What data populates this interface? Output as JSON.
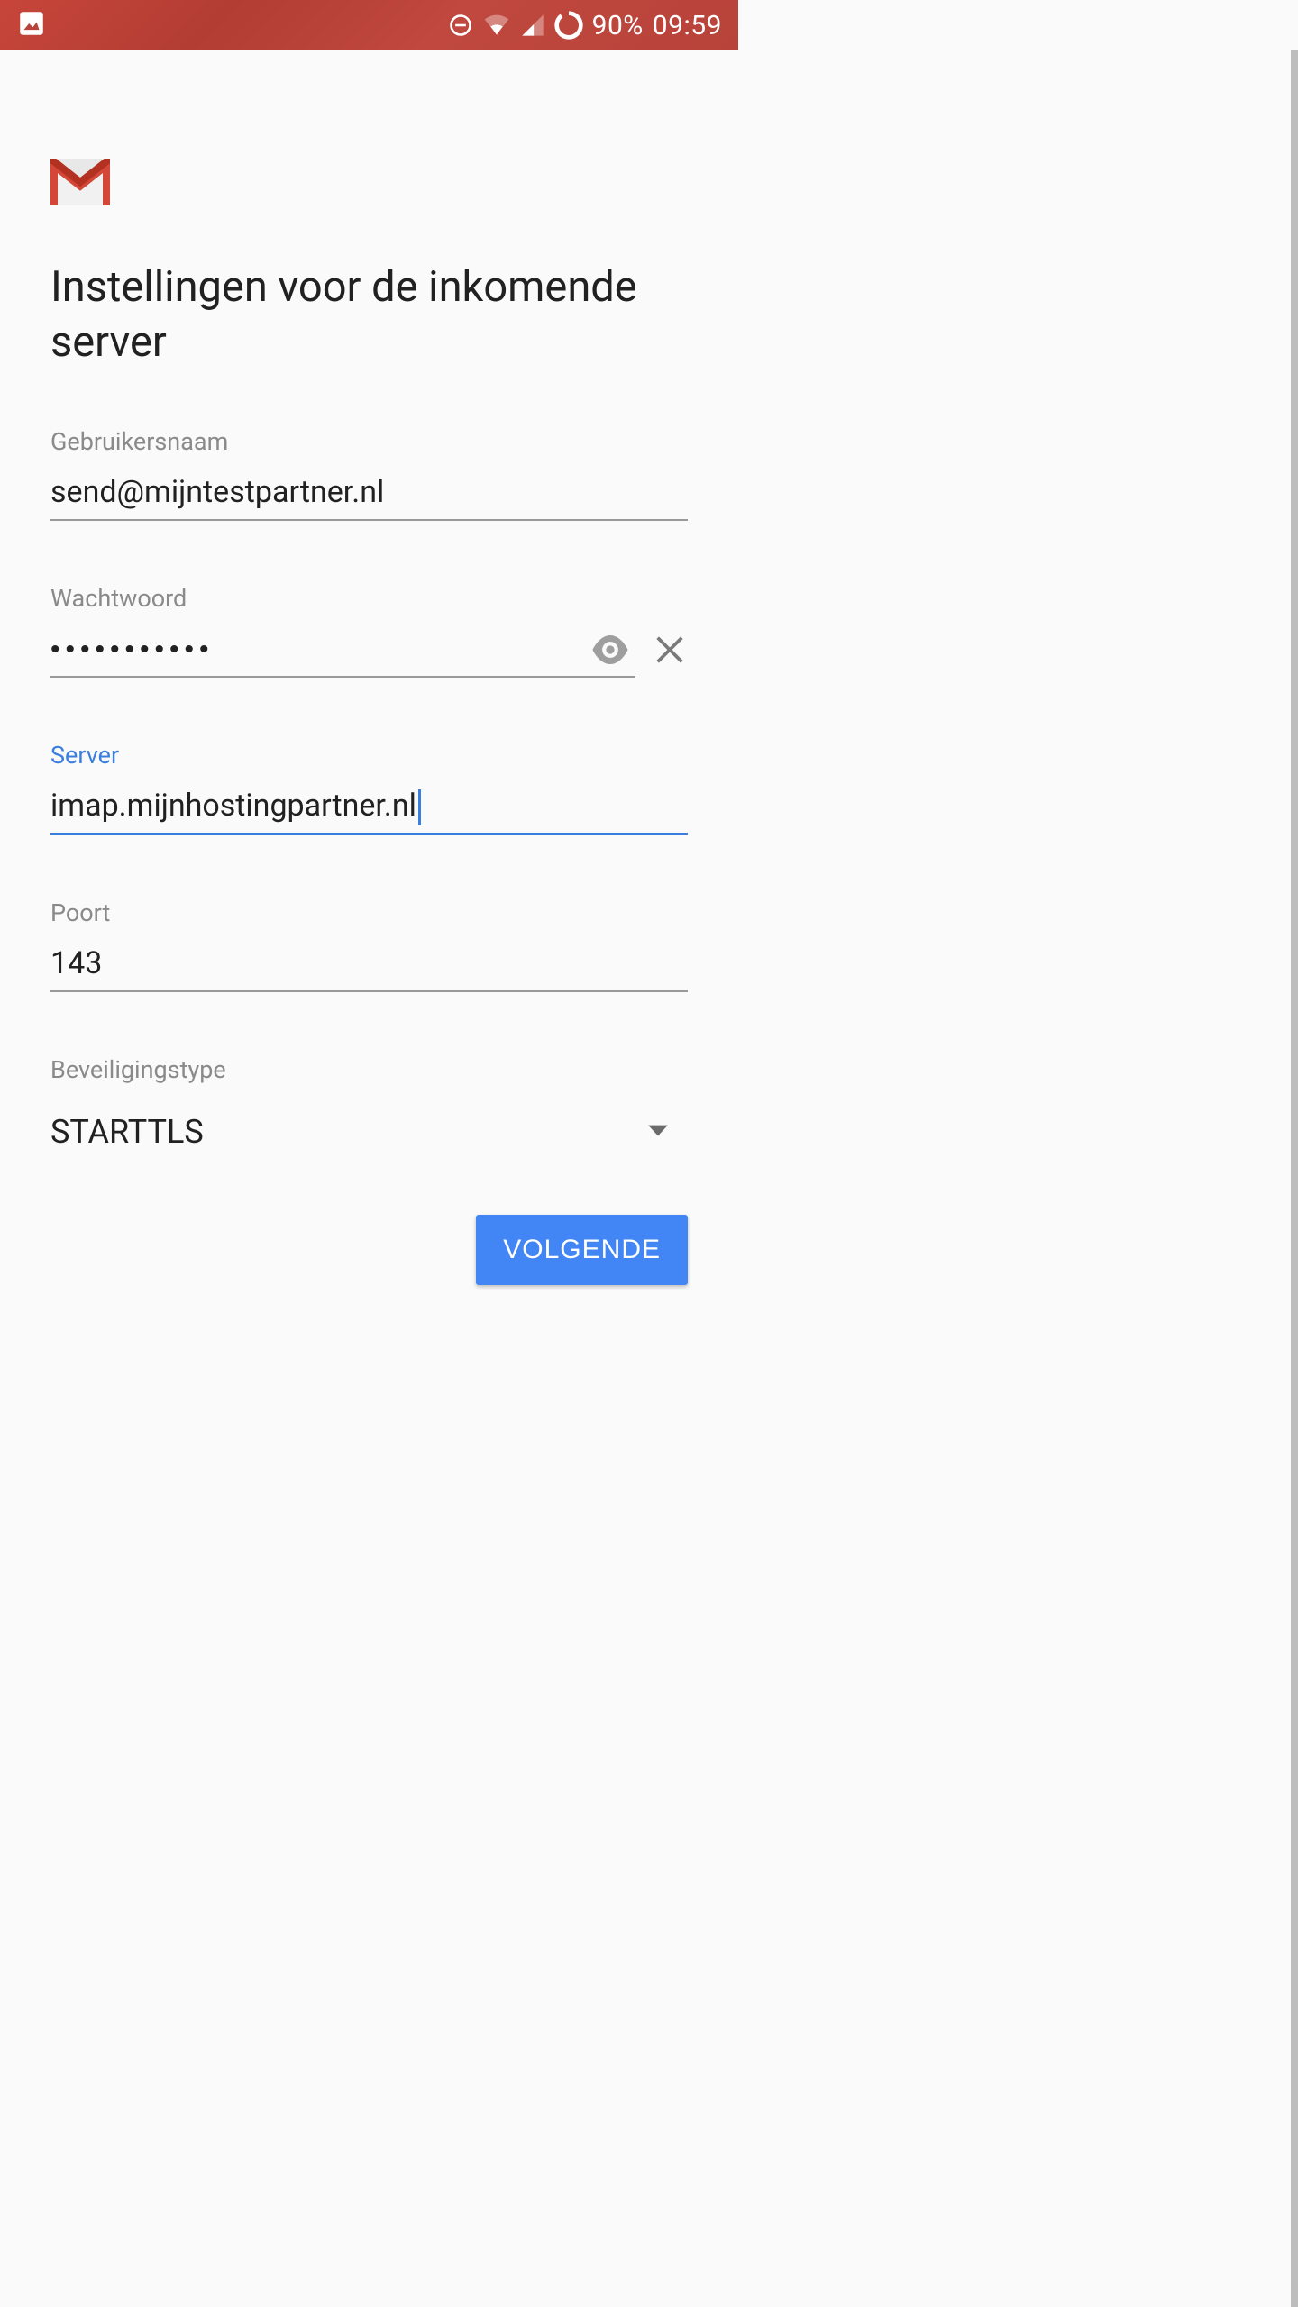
{
  "status_bar": {
    "battery_text": "90%",
    "time": "09:59"
  },
  "page": {
    "title": "Instellingen voor de inkomende server"
  },
  "fields": {
    "username": {
      "label": "Gebruikersnaam",
      "value": "send@mijntestpartner.nl"
    },
    "password": {
      "label": "Wachtwoord",
      "value_masked": "•••••••••••"
    },
    "server": {
      "label": "Server",
      "value": "imap.mijnhostingpartner.nl"
    },
    "port": {
      "label": "Poort",
      "value": "143"
    },
    "security": {
      "label": "Beveiligingstype",
      "value": "STARTTLS"
    }
  },
  "buttons": {
    "next": "VOLGENDE"
  }
}
